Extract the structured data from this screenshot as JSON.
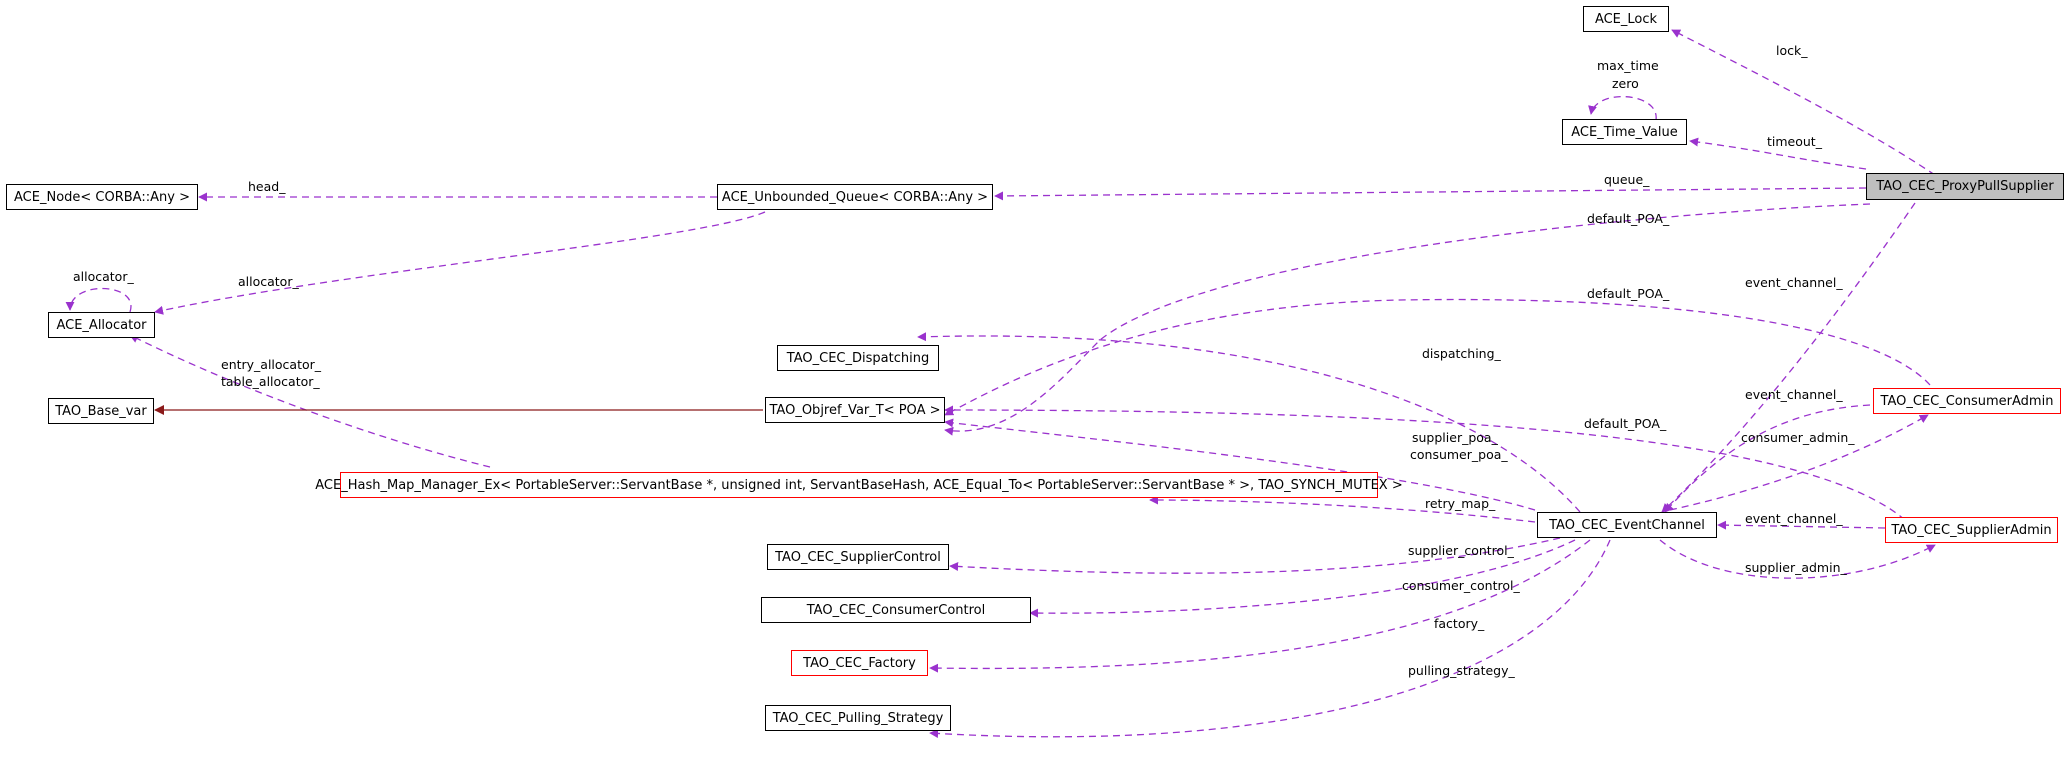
{
  "nodes": {
    "ace_lock": "ACE_Lock",
    "ace_time_value": "ACE_Time_Value",
    "proxy_pull_supplier": "TAO_CEC_ProxyPullSupplier",
    "ace_node": "ACE_Node< CORBA::Any >",
    "unbounded_queue": "ACE_Unbounded_Queue< CORBA::Any >",
    "ace_allocator": "ACE_Allocator",
    "dispatching": "TAO_CEC_Dispatching",
    "base_var": "TAO_Base_var",
    "objref_var": "TAO_Objref_Var_T< POA >",
    "hash_map_manager": "ACE_Hash_Map_Manager_Ex< PortableServer::ServantBase *, unsigned int, ServantBaseHash, ACE_Equal_To< PortableServer::ServantBase * >, TAO_SYNCH_MUTEX >",
    "consumer_admin": "TAO_CEC_ConsumerAdmin",
    "event_channel": "TAO_CEC_EventChannel",
    "supplier_admin": "TAO_CEC_SupplierAdmin",
    "supplier_control": "TAO_CEC_SupplierControl",
    "consumer_control": "TAO_CEC_ConsumerControl",
    "factory": "TAO_CEC_Factory",
    "pulling_strategy": "TAO_CEC_Pulling_Strategy"
  },
  "edge_labels": {
    "lock": "lock_",
    "max_time": "max_time",
    "zero": "zero",
    "timeout": "timeout_",
    "queue": "queue_",
    "head": "head_",
    "default_poa_top": "default_POA_",
    "allocator_queue": "allocator_",
    "allocator_self": "allocator_",
    "event_channel_proxy": "event_channel_",
    "default_poa_consumer": "default_POA_",
    "entry_allocator": "entry_allocator_",
    "table_allocator": "table_allocator_",
    "dispatching": "dispatching_",
    "event_channel_consumer": "event_channel_",
    "default_poa_supplier": "default_POA_",
    "supplier_poa": "supplier_poa_",
    "consumer_poa": "consumer_poa_",
    "consumer_admin": "consumer_admin_",
    "retry_map": "retry_map_",
    "event_channel_supplier": "event_channel_",
    "supplier_control": "supplier_control_",
    "supplier_admin": "supplier_admin_",
    "consumer_control": "consumer_control_",
    "factory": "factory_",
    "pulling_strategy": "pulling_strategy_"
  },
  "colors": {
    "association_edge": "#9a32cd",
    "inheritance_edge": "#8b1a1a",
    "focus_fill": "#bfbfbf",
    "truncated_border": "#ff0000"
  }
}
